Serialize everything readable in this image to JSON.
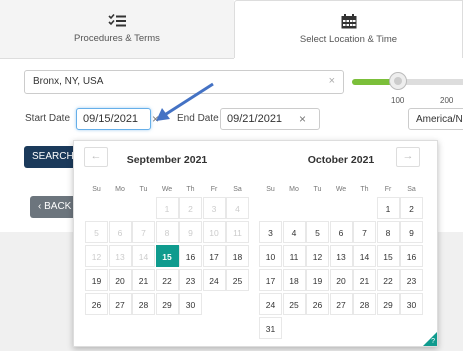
{
  "tabs": [
    {
      "label": "Procedures & Terms",
      "icon": "checklist-icon"
    },
    {
      "label": "Select Location & Time",
      "icon": "calendar-icon"
    }
  ],
  "location": {
    "value": "Bronx, NY, USA",
    "clear": "×"
  },
  "slider": {
    "ticks": [
      "100",
      "200"
    ],
    "accent": "#7bbf3a",
    "level_fraction": 0.38
  },
  "dates": {
    "start_label": "Start Date",
    "start_value": "09/15/2021",
    "end_label": "End Date",
    "end_value": "09/21/2021",
    "clear": "×"
  },
  "timezone": {
    "value": "America/Ne"
  },
  "buttons": {
    "search": "SEARCH",
    "back": "‹ BACK"
  },
  "colors": {
    "selected": "#0f9b8e",
    "search_btn": "#1b3a5b",
    "back_btn": "#6c757d",
    "annotation_arrow": "#4472c4"
  },
  "calendar": {
    "prev": "←",
    "next": "→",
    "weekdays": [
      "Su",
      "Mo",
      "Tu",
      "We",
      "Th",
      "Fr",
      "Sa"
    ],
    "months": [
      {
        "title": "September 2021",
        "weeks": [
          [
            "",
            "",
            "",
            "1",
            "2",
            "3",
            "4"
          ],
          [
            "5",
            "6",
            "7",
            "8",
            "9",
            "10",
            "11"
          ],
          [
            "12",
            "13",
            "14",
            "15",
            "16",
            "17",
            "18"
          ],
          [
            "19",
            "20",
            "21",
            "22",
            "23",
            "24",
            "25"
          ],
          [
            "26",
            "27",
            "28",
            "29",
            "30",
            "",
            ""
          ]
        ]
      },
      {
        "title": "October 2021",
        "weeks": [
          [
            "",
            "",
            "",
            "",
            "",
            "1",
            "2"
          ],
          [
            "3",
            "4",
            "5",
            "6",
            "7",
            "8",
            "9"
          ],
          [
            "10",
            "11",
            "12",
            "13",
            "14",
            "15",
            "16"
          ],
          [
            "17",
            "18",
            "19",
            "20",
            "21",
            "22",
            "23"
          ],
          [
            "24",
            "25",
            "26",
            "27",
            "28",
            "29",
            "30"
          ],
          [
            "31",
            "",
            "",
            "",
            "",
            "",
            ""
          ]
        ]
      }
    ],
    "selected": {
      "month": 0,
      "day": "15"
    },
    "disabled_before": {
      "month": 0,
      "day": 15
    },
    "help": "?"
  }
}
